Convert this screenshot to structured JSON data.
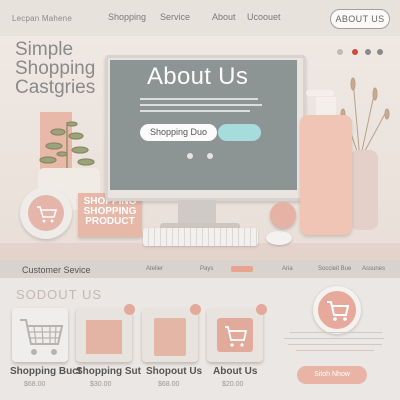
{
  "header": {
    "brand": "Lecpan Mahene",
    "nav": [
      "Shopping",
      "Service",
      "About",
      "Ucoouet"
    ],
    "cta": "ABOUT US"
  },
  "hero": {
    "tagline": [
      "Simple",
      "Shopping",
      "Castgries"
    ],
    "screen_title": "About Us",
    "screen_button": "Shopping Duo",
    "product_box": [
      "SHOPPING",
      "SHOPPING",
      "PRODUCT"
    ]
  },
  "strip": {
    "label": "Customer Sevice",
    "items": [
      "Atelier",
      "Pays",
      "Aria",
      "Soccieit Bue",
      "Assunes"
    ]
  },
  "section": {
    "title": "SODOUT US",
    "cards": [
      {
        "label": "Shopping Buct",
        "price": "$68.00"
      },
      {
        "label": "Shopping Sut",
        "price": "$30.00"
      },
      {
        "label": "Shopout Us",
        "price": "$68.00"
      },
      {
        "label": "About Us",
        "price": "$20.00"
      }
    ],
    "shop_button": "Sitoh Nhow"
  },
  "colors": {
    "accent": "#e6a99c",
    "screen": "#8c9494",
    "teal": "#a7dcdc"
  }
}
